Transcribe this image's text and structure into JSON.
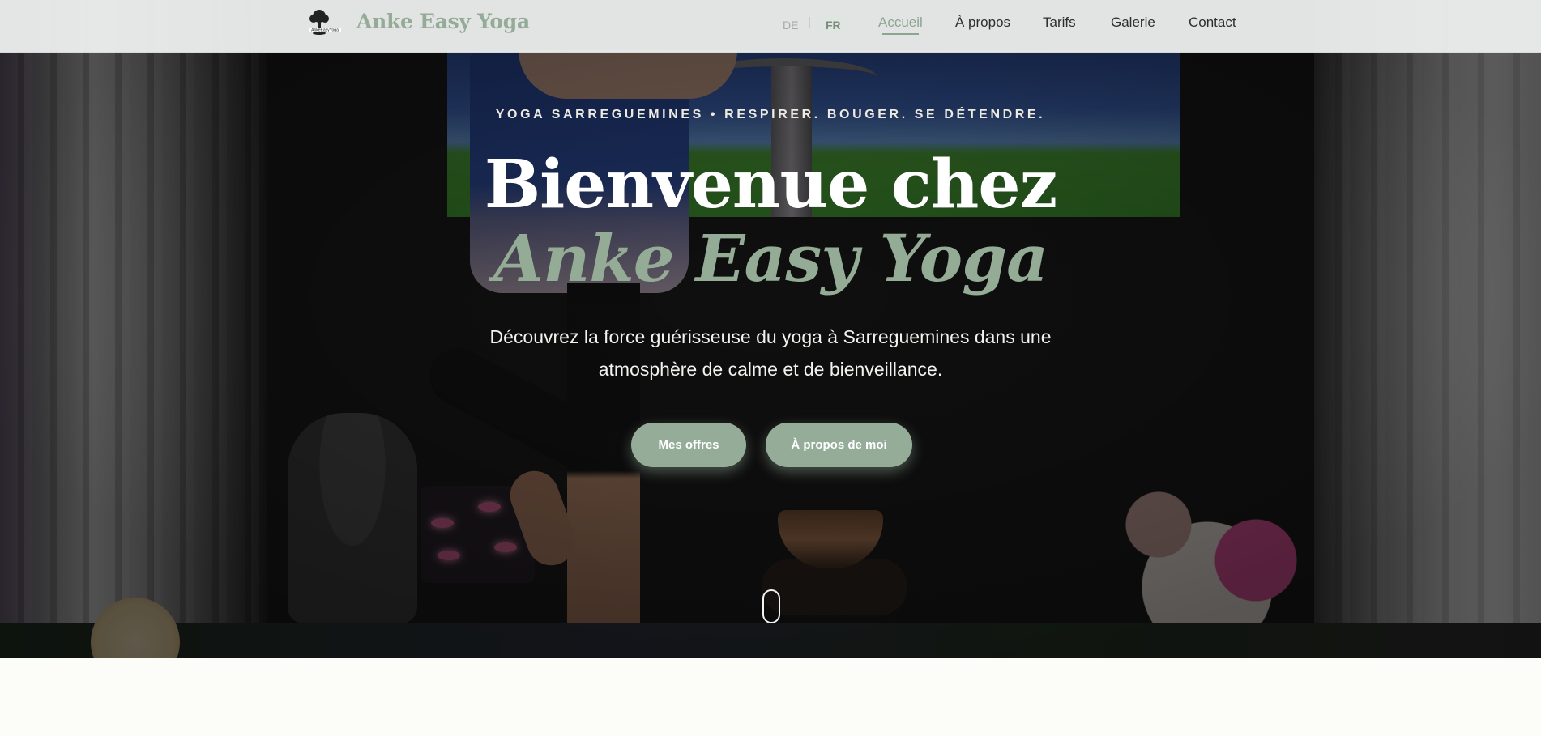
{
  "header": {
    "brand_name": "Anke Easy Yoga",
    "logo_text": "AnkeEasyYoga",
    "languages": {
      "de": "DE",
      "separator": "|",
      "fr": "FR",
      "active": "FR"
    },
    "nav": [
      {
        "label": "Accueil",
        "active": true
      },
      {
        "label": "À propos",
        "active": false
      },
      {
        "label": "Tarifs",
        "active": false
      },
      {
        "label": "Galerie",
        "active": false
      },
      {
        "label": "Contact",
        "active": false
      }
    ]
  },
  "hero": {
    "eyebrow": "YOGA SARREGUEMINES • RESPIRER. BOUGER. SE DÉTENDRE.",
    "title_line1": "Bienvenue chez",
    "title_line2": "Anke Easy Yoga",
    "subtitle": "Découvrez la force guérisseuse du yoga à Sarreguemines dans une atmosphère de calme et de bienveillance.",
    "buttons": {
      "offers": "Mes offres",
      "about": "À propos de moi"
    }
  },
  "colors": {
    "accent": "#95ad98",
    "brand_title": "#93ab97",
    "header_bg": "#eef0f0",
    "page_bg": "#fcfdf8",
    "text_dark": "#2c2f2e"
  },
  "icons": {
    "logo": "tree-icon",
    "scroll": "mouse-scroll-icon"
  }
}
